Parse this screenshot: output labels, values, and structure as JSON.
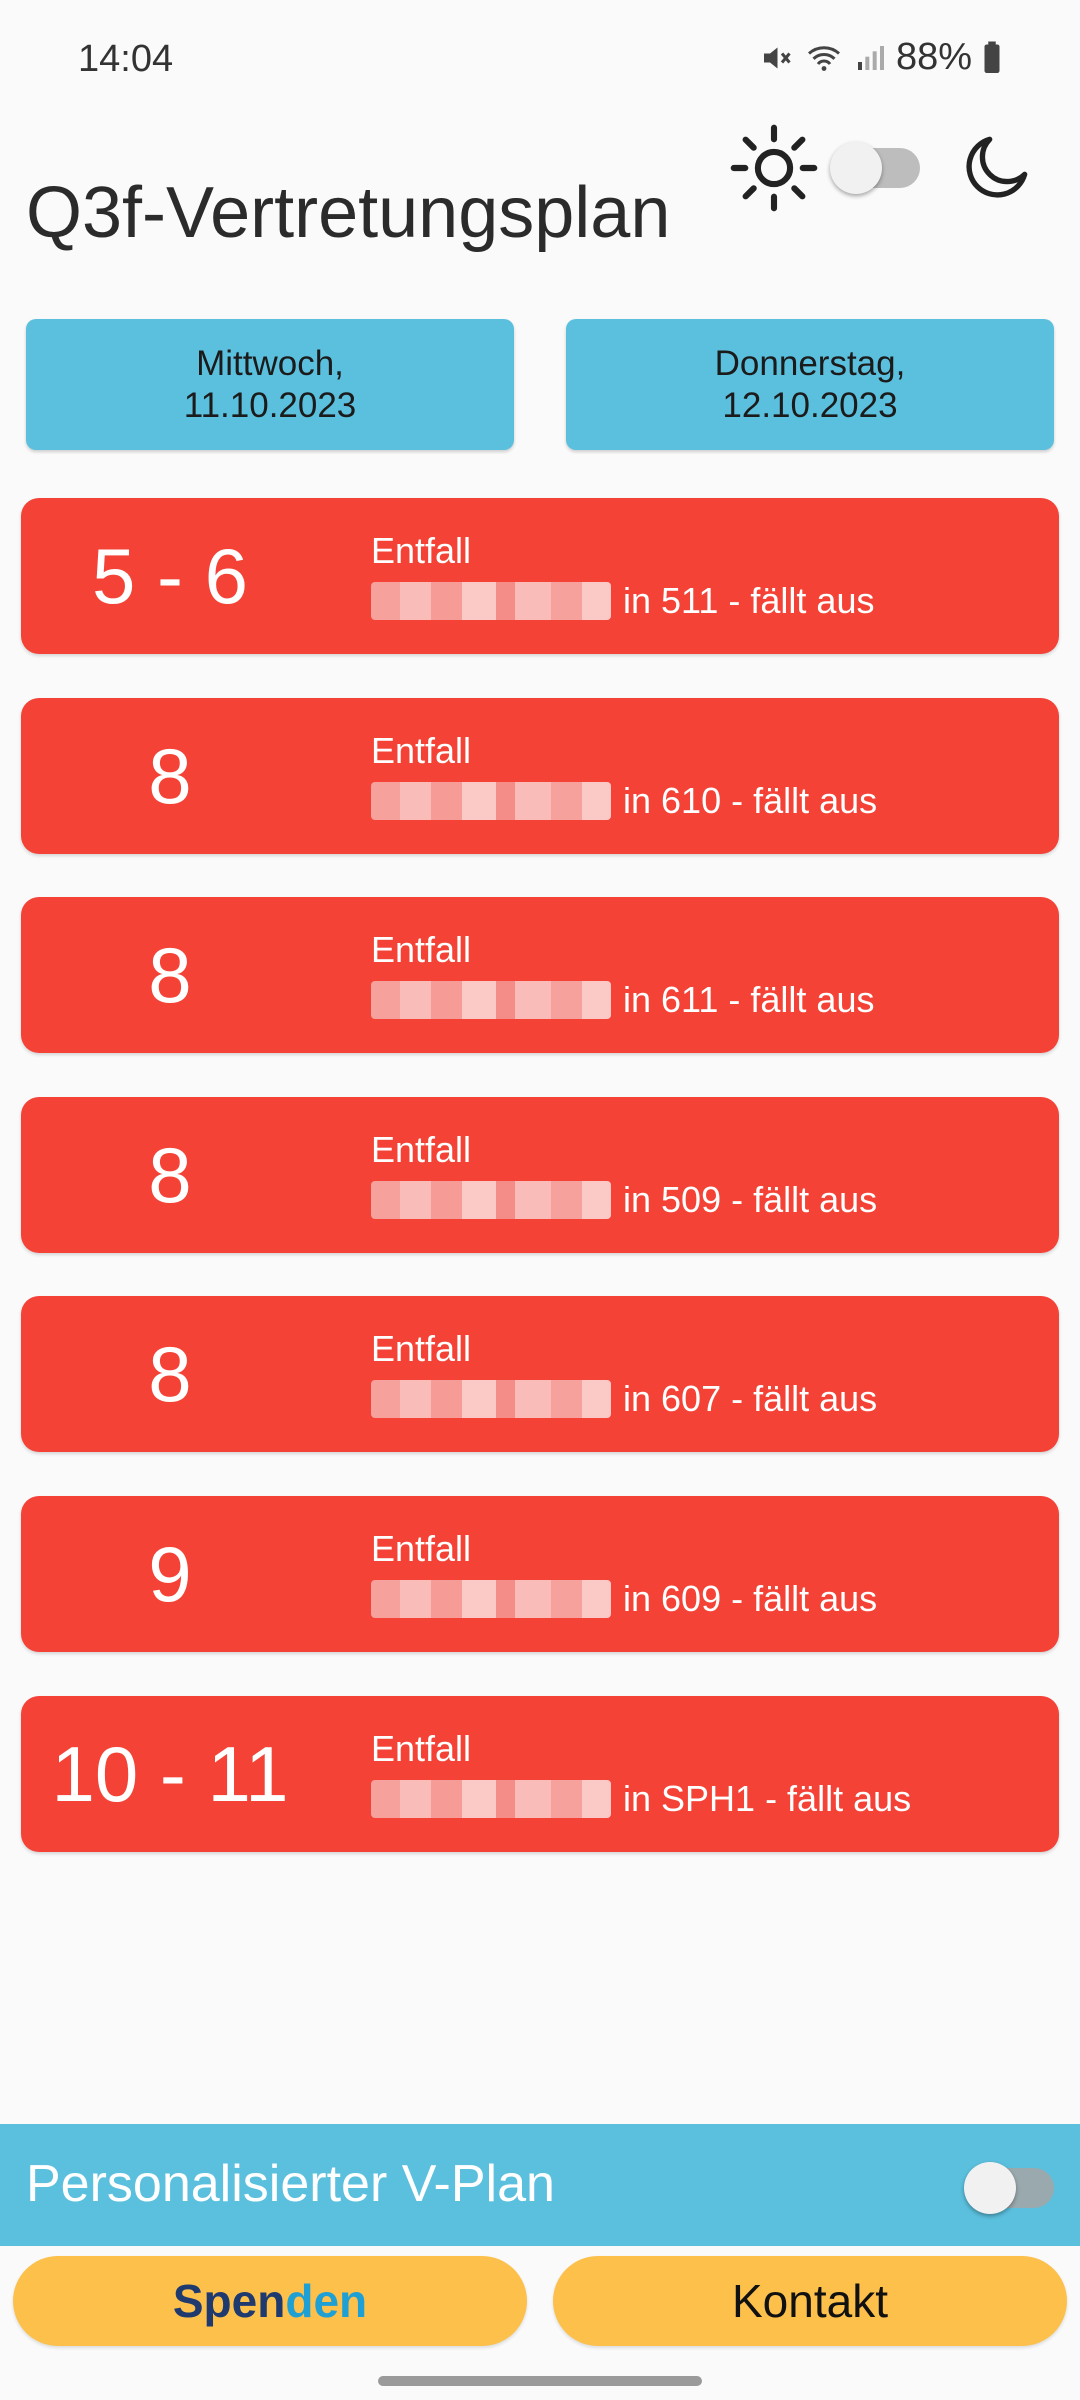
{
  "status_bar": {
    "time": "14:04",
    "battery": "88%"
  },
  "header": {
    "title": "Q3f-Vertretungsplan"
  },
  "days": [
    {
      "line1": "Mittwoch,",
      "line2": "11.10.2023"
    },
    {
      "line1": "Donnerstag,",
      "line2": "12.10.2023"
    }
  ],
  "entries": [
    {
      "period": "5 - 6",
      "type": "Entfall",
      "detail": "in 511 - fällt aus"
    },
    {
      "period": "8",
      "type": "Entfall",
      "detail": "in 610 - fällt aus"
    },
    {
      "period": "8",
      "type": "Entfall",
      "detail": "in 611 - fällt aus"
    },
    {
      "period": "8",
      "type": "Entfall",
      "detail": "in 509 - fällt aus"
    },
    {
      "period": "8",
      "type": "Entfall",
      "detail": "in 607 - fällt aus"
    },
    {
      "period": "9",
      "type": "Entfall",
      "detail": "in 609 - fällt aus"
    },
    {
      "period": "10 - 11",
      "type": "Entfall",
      "detail": "in SPH1 - fällt aus"
    }
  ],
  "personalized": {
    "label": "Personalisierter V-Plan"
  },
  "buttons": {
    "donate_part1": "Spen",
    "donate_part2": "den",
    "contact": "Kontakt"
  },
  "colors": {
    "entry_bg": "#f44336",
    "day_button_bg": "#5bc0de",
    "bottom_button_bg": "#fcc04b"
  }
}
